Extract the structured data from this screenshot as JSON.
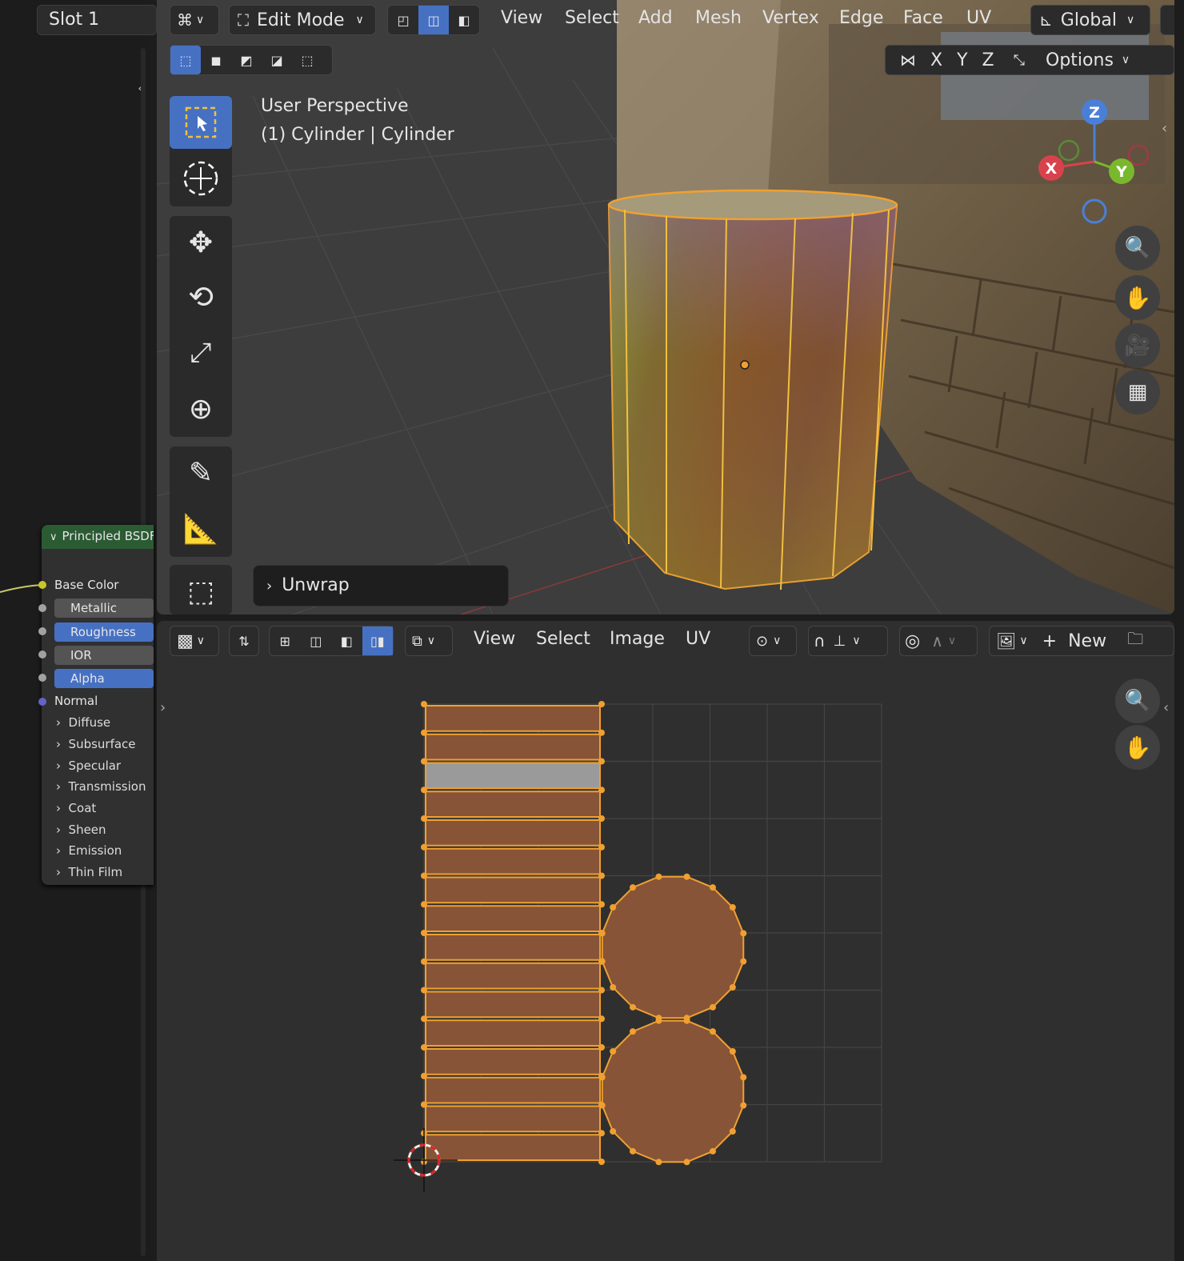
{
  "node_editor": {
    "slot": "Slot 1",
    "node_title": "Principled BSDF",
    "inputs": {
      "base_color": "Base Color",
      "metallic": "Metallic",
      "roughness": "Roughness",
      "ior": "IOR",
      "alpha": "Alpha",
      "normal": "Normal"
    },
    "panels": [
      "Diffuse",
      "Subsurface",
      "Specular",
      "Transmission",
      "Coat",
      "Sheen",
      "Emission",
      "Thin Film"
    ]
  },
  "viewport": {
    "mode": "Edit Mode",
    "menus": [
      "View",
      "Select",
      "Add",
      "Mesh",
      "Vertex",
      "Edge",
      "Face",
      "UV"
    ],
    "orientation": "Global",
    "axis_x": "X",
    "axis_y": "Y",
    "axis_z": "Z",
    "options": "Options",
    "overlay_title": "User Perspective",
    "overlay_object_prefix": "(1) Cylinder",
    "overlay_object_suffix": "Cylinder",
    "gizmo_x": "X",
    "gizmo_y": "Y",
    "gizmo_z": "Z",
    "last_operator": "Unwrap"
  },
  "uv_editor": {
    "menus": [
      "View",
      "Select",
      "Image",
      "UV"
    ],
    "new_label": "New"
  },
  "colors": {
    "accent_blue": "#4671c3",
    "selection_orange": "#f0a030",
    "node_header_green": "#2b5b33",
    "uv_face_fill": "#875437",
    "selected_face": "#9a9a9a"
  }
}
